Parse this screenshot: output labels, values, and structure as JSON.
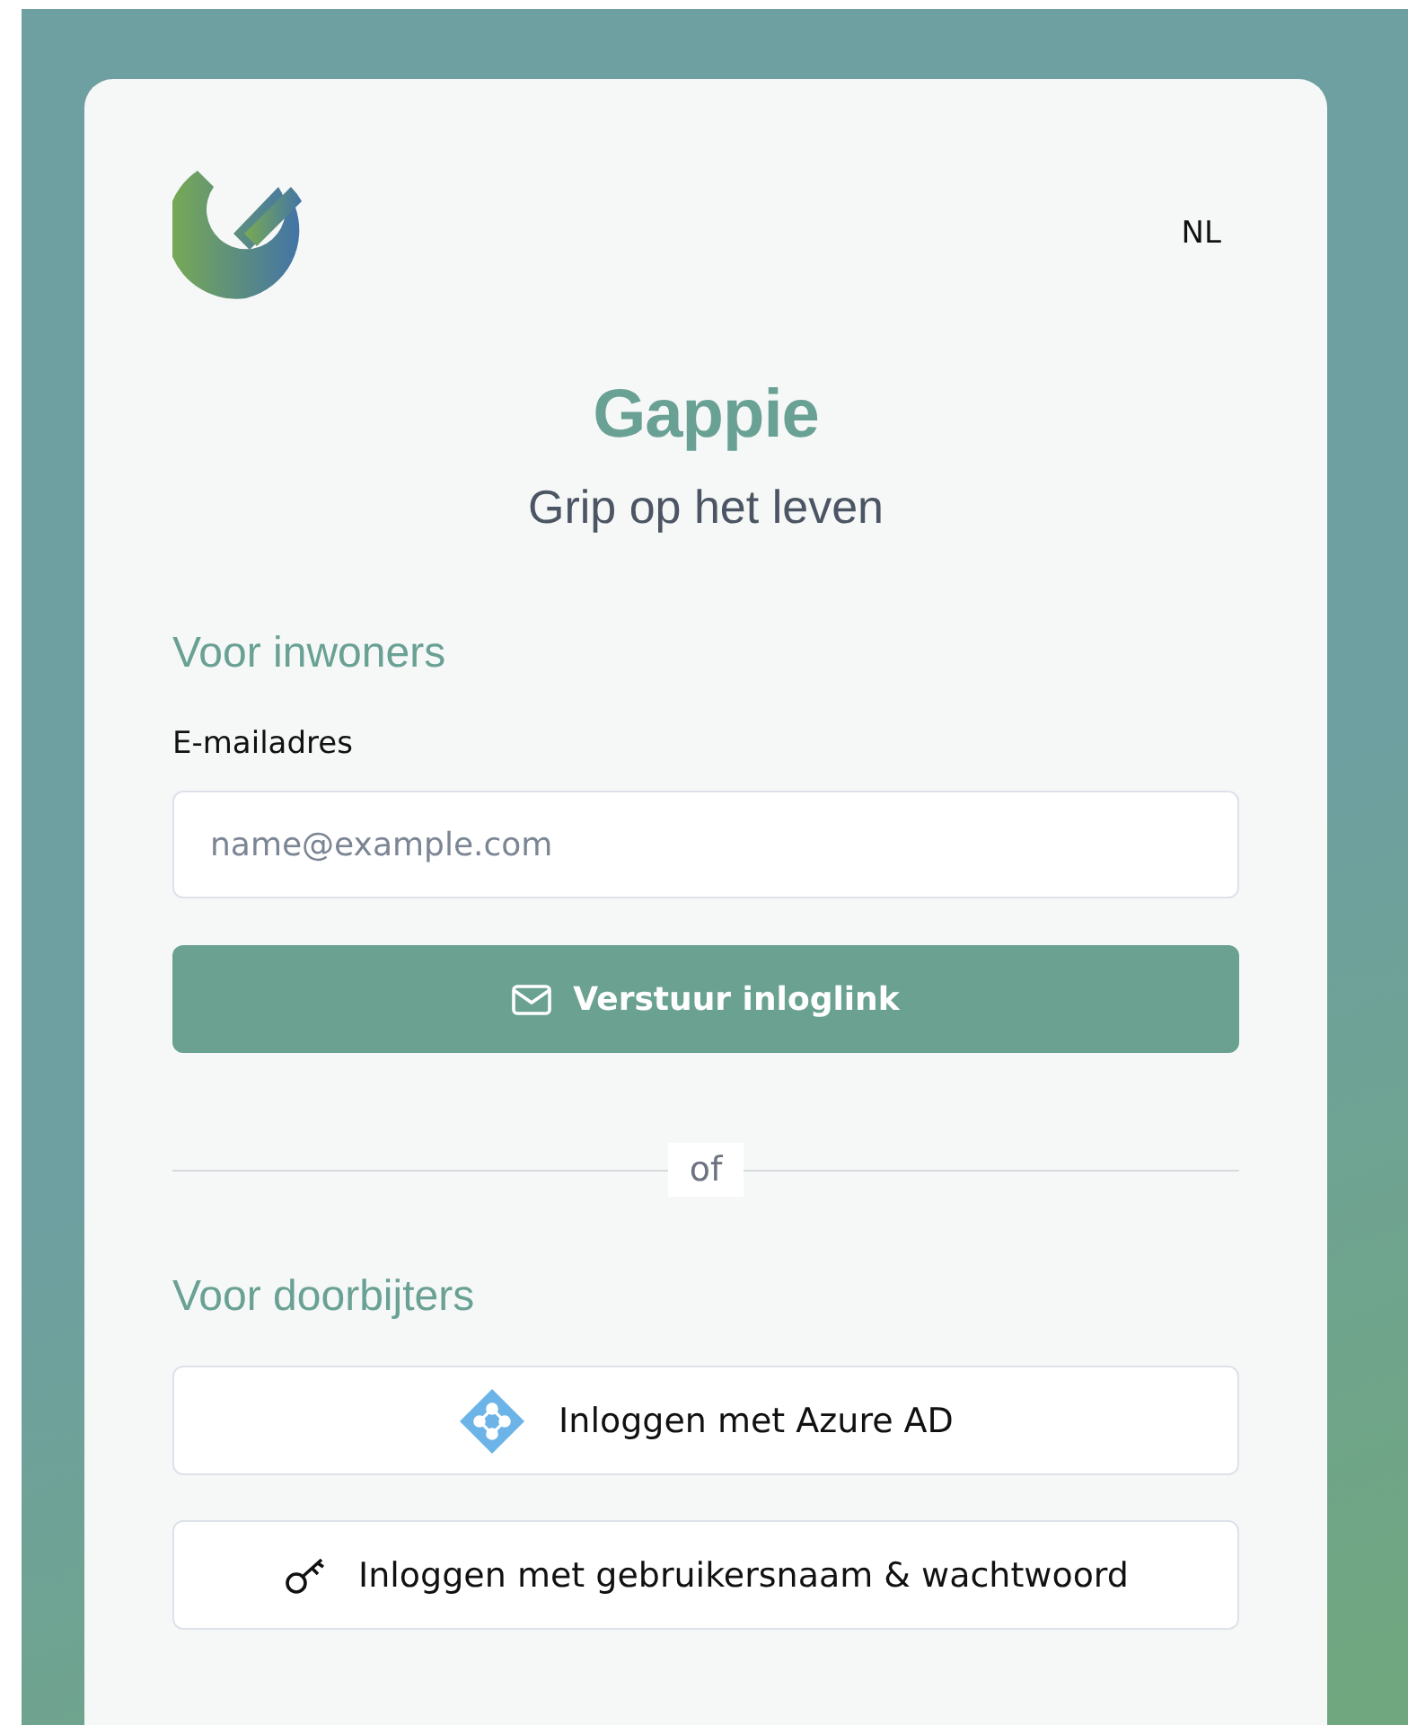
{
  "language": "NL",
  "brand": {
    "name": "Gappie",
    "tagline": "Grip op het leven"
  },
  "residents": {
    "heading": "Voor inwoners",
    "email_label": "E-mailadres",
    "placeholder": "name@example.com",
    "submit": "Verstuur inloglink"
  },
  "divider": "of",
  "professionals": {
    "heading": "Voor doorbijters",
    "buttons": [
      {
        "kind": "azure",
        "label": "Inloggen met Azure AD"
      },
      {
        "kind": "key",
        "label": "Inloggen met gebruikersnaam & wachtwoord"
      }
    ]
  }
}
